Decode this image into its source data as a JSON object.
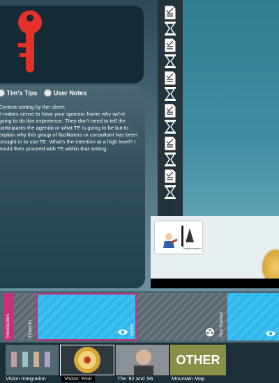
{
  "notes": {
    "tabs": [
      {
        "label": "Tim's Tips"
      },
      {
        "label": "User Notes"
      }
    ],
    "text": "Context setting by the client:\nIt makes sense to have your sponsor frame why we're going to do this experience. They don't need to tell the participants the agenda or what TE is going to be but to explain why this group of facilitators or consultant has been brought in to use TE. What's the intention at a high level? I would then proceed with TE within that setting."
  },
  "preview": {
    "thumb_caption": "Transformation"
  },
  "timeline": {
    "segments": [
      {
        "label": "Introduction"
      },
      {
        "label": "Thank-in"
      },
      {
        "label": "Vision"
      },
      {
        "label": "Your Everest"
      }
    ]
  },
  "bottom": {
    "thumbnails": [
      {
        "caption": "Vision Integration"
      },
      {
        "caption": "Vision: Four"
      },
      {
        "caption": "The '82 and '86"
      },
      {
        "caption": "Mountain Map"
      }
    ],
    "other_label": "OTHER"
  },
  "colors": {
    "key": "#e5312b",
    "cyan": "#2fb6ec",
    "pink": "#c8307a"
  },
  "icons": [
    "key-icon",
    "checklist-icon",
    "hourglass-icon",
    "eye-icon",
    "film-icon"
  ]
}
